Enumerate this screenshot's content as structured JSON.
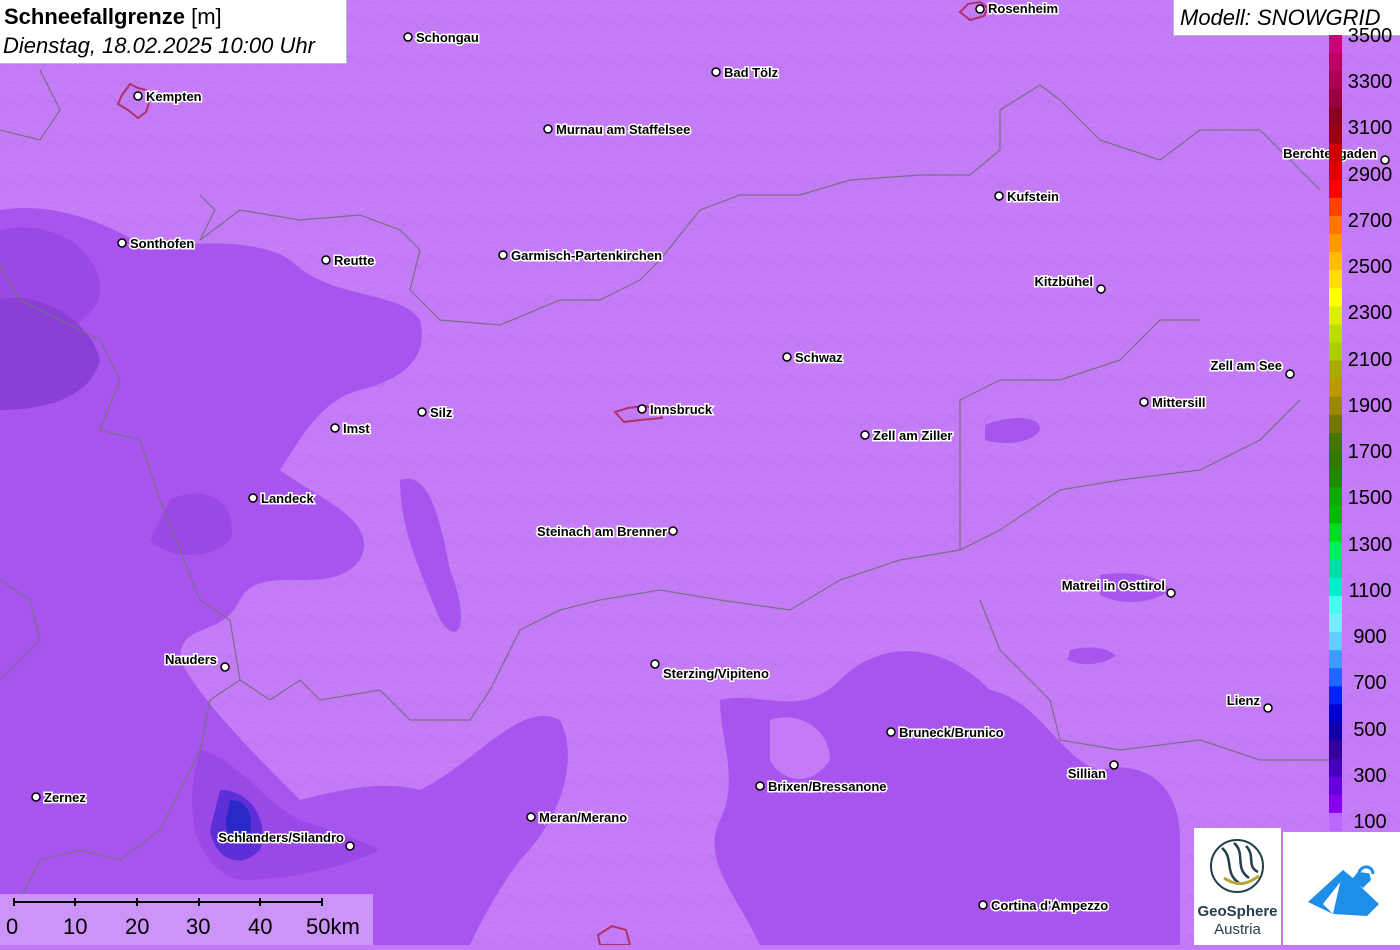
{
  "title": {
    "main": "Schneefallgrenze",
    "unit": "[m]",
    "date": "Dienstag, 18.02.2025 10:00 Uhr"
  },
  "model": "Modell: SNOWGRID",
  "legend": {
    "labels": [
      "3500",
      "3300",
      "3100",
      "2900",
      "2700",
      "2500",
      "2300",
      "2100",
      "1900",
      "1700",
      "1500",
      "1300",
      "1100",
      "900",
      "700",
      "500",
      "300",
      "100"
    ],
    "colors": [
      "#cc0077",
      "#bb0066",
      "#aa0055",
      "#990044",
      "#880022",
      "#990011",
      "#cc0000",
      "#dd0000",
      "#ff0000",
      "#ff4400",
      "#ff7700",
      "#ff9900",
      "#ffbb00",
      "#ffdd00",
      "#ffff00",
      "#ddee00",
      "#bbdd00",
      "#aacc00",
      "#aaaa00",
      "#bb9900",
      "#998800",
      "#777700",
      "#447700",
      "#337700",
      "#228800",
      "#11aa00",
      "#00bb00",
      "#00dd22",
      "#00ee66",
      "#00ddaa",
      "#00eecc",
      "#44ffee",
      "#77eeff",
      "#66ccff",
      "#4499ff",
      "#2266ff",
      "#0022ff",
      "#0000cc",
      "#1100aa",
      "#330099",
      "#4400bb",
      "#6600dd",
      "#8800ee",
      "#bb66ff"
    ]
  },
  "scale": {
    "ticks": [
      "0",
      "10",
      "20",
      "30",
      "40",
      "50km"
    ]
  },
  "logos": {
    "geosphere_line1": "GeoSphere",
    "geosphere_line2": "Austria"
  },
  "cities": [
    {
      "name": "Schongau"
    },
    {
      "name": "Rosenheim"
    },
    {
      "name": "Kempten"
    },
    {
      "name": "Bad Tölz"
    },
    {
      "name": "Murnau am Staffelsee"
    },
    {
      "name": "Berchtesgaden"
    },
    {
      "name": "Kufstein"
    },
    {
      "name": "Sonthofen"
    },
    {
      "name": "Reutte"
    },
    {
      "name": "Garmisch-Partenkirchen"
    },
    {
      "name": "Kitzbühel"
    },
    {
      "name": "Schwaz"
    },
    {
      "name": "Zell am See"
    },
    {
      "name": "Mittersill"
    },
    {
      "name": "Imst"
    },
    {
      "name": "Silz"
    },
    {
      "name": "Innsbruck"
    },
    {
      "name": "Zell am Ziller"
    },
    {
      "name": "Landeck"
    },
    {
      "name": "Steinach am Brenner"
    },
    {
      "name": "Matrei in Osttirol"
    },
    {
      "name": "Nauders"
    },
    {
      "name": "Sterzing/Vipiteno"
    },
    {
      "name": "Lienz"
    },
    {
      "name": "Bruneck/Brunico"
    },
    {
      "name": "Sillian"
    },
    {
      "name": "Brixen/Bressanone"
    },
    {
      "name": "Zernez"
    },
    {
      "name": "Meran/Merano"
    },
    {
      "name": "Schlanders/Silandro"
    },
    {
      "name": "Cortina d'Ampezzo"
    }
  ]
}
